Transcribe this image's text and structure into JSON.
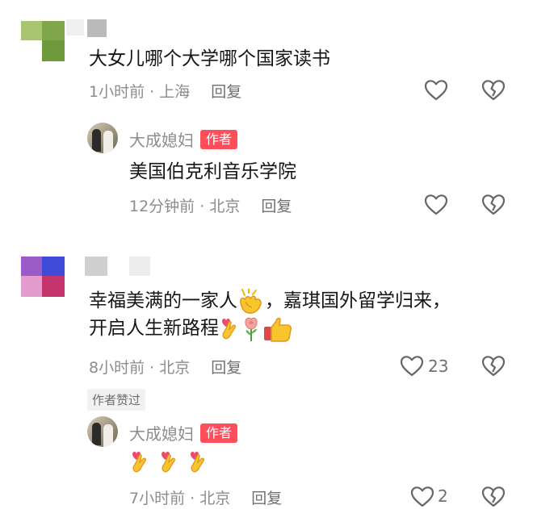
{
  "comments": [
    {
      "text": "大女儿哪个大学哪个国家读书",
      "time": "1小时前",
      "dot": "·",
      "location": "上海",
      "reply_label": "回复",
      "reply": {
        "author": "大成媳妇",
        "badge": "作者",
        "text": "美国伯克利音乐学院",
        "time": "12分钟前",
        "dot": "·",
        "location": "北京",
        "reply_label": "回复"
      }
    },
    {
      "text_line1": "幸福美满的一家人",
      "text_line1_b": "，嘉琪国外留学归来，",
      "text_line2": "开启人生新路程",
      "time": "8小时前",
      "dot": "·",
      "location": "北京",
      "reply_label": "回复",
      "like_count": "23",
      "author_liked": "作者赞过",
      "reply": {
        "author": "大成媳妇",
        "badge": "作者",
        "time": "7小时前",
        "dot": "·",
        "location": "北京",
        "reply_label": "回复",
        "like_count": "2"
      }
    }
  ],
  "icons": [
    "heart-icon",
    "broken-heart-icon",
    "clapping-hands-emoji",
    "crossed-fingers-heart-emoji",
    "rose-emoji",
    "thumbs-up-emoji"
  ],
  "colors": {
    "badge": "#ff4d5a",
    "meta": "#8c8c8c",
    "text": "#161616"
  }
}
